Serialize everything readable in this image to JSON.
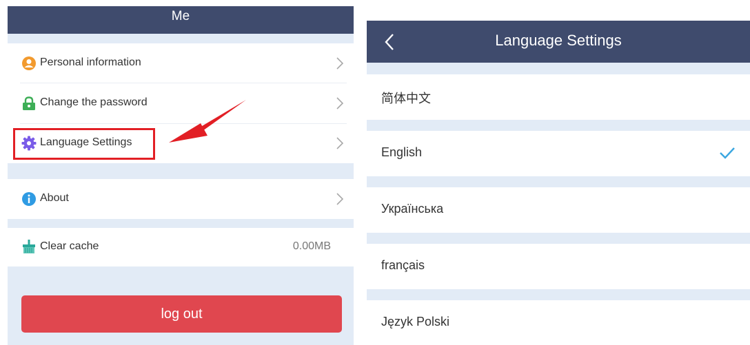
{
  "me_screen": {
    "title": "Me",
    "menu": [
      {
        "label": "Personal information",
        "icon": "person-circle-icon"
      },
      {
        "label": "Change the password",
        "icon": "lock-icon"
      },
      {
        "label": "Language Settings",
        "icon": "gear-icon"
      },
      {
        "label": "About",
        "icon": "info-icon"
      },
      {
        "label": "Clear cache",
        "icon": "broom-icon",
        "value": "0.00MB"
      }
    ],
    "logout_label": "log out"
  },
  "language_screen": {
    "title": "Language Settings",
    "languages": [
      {
        "label": "简体中文",
        "selected": false
      },
      {
        "label": "English",
        "selected": true
      },
      {
        "label": "Українська",
        "selected": false
      },
      {
        "label": "français",
        "selected": false
      },
      {
        "label": "Język Polski",
        "selected": false
      }
    ]
  },
  "colors": {
    "header": "#3f4b6d",
    "background": "#e2ebf6",
    "logout": "#e0474f",
    "highlight": "#e21f25",
    "check": "#3aa6e0"
  }
}
